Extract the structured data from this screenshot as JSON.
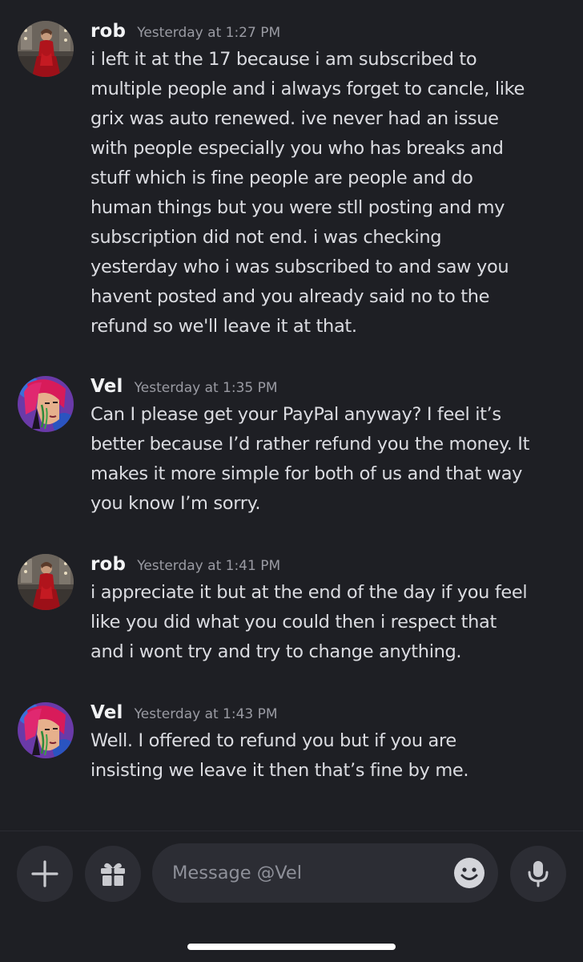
{
  "messages": [
    {
      "author": "rob",
      "timestamp": "Yesterday at 1:27 PM",
      "text": "i left it at the 17 because i am subscribed to\nmultiple people and i always forget to cancle, like\ngrix was auto renewed. ive never had an issue\nwith people especially you who has breaks and\nstuff which is fine people are people and do\nhuman things but you were stll posting and my\nsubscription did not end. i was checking\nyesterday who i was subscribed to and saw you\nhavent posted and you already said no to the\nrefund so we'll leave it at that."
    },
    {
      "author": "Vel",
      "timestamp": "Yesterday at 1:35 PM",
      "text": "Can I please get your PayPal anyway? I feel it’s\nbetter because I’d rather refund you the money. It\nmakes it more simple for both of us and that way\nyou know I’m sorry."
    },
    {
      "author": "rob",
      "timestamp": "Yesterday at 1:41 PM",
      "text": "i appreciate it but at the end of the day if you feel\nlike you did what you could then i respect that\nand i wont try and try to change anything."
    },
    {
      "author": "Vel",
      "timestamp": "Yesterday at 1:43 PM",
      "text": "Well. I offered to refund you but if you are\ninsisting we leave it then that’s fine by me."
    }
  ],
  "composer": {
    "placeholder": "Message @Vel",
    "buttons": [
      "plus-icon",
      "gift-icon",
      "emoji-icon",
      "microphone-icon"
    ]
  },
  "colors": {
    "background": "#1e1f24",
    "input_background": "#2c2d34",
    "username": "#f2f3f5",
    "timestamp": "#9a9ba3",
    "message_text": "#dbdce1"
  }
}
